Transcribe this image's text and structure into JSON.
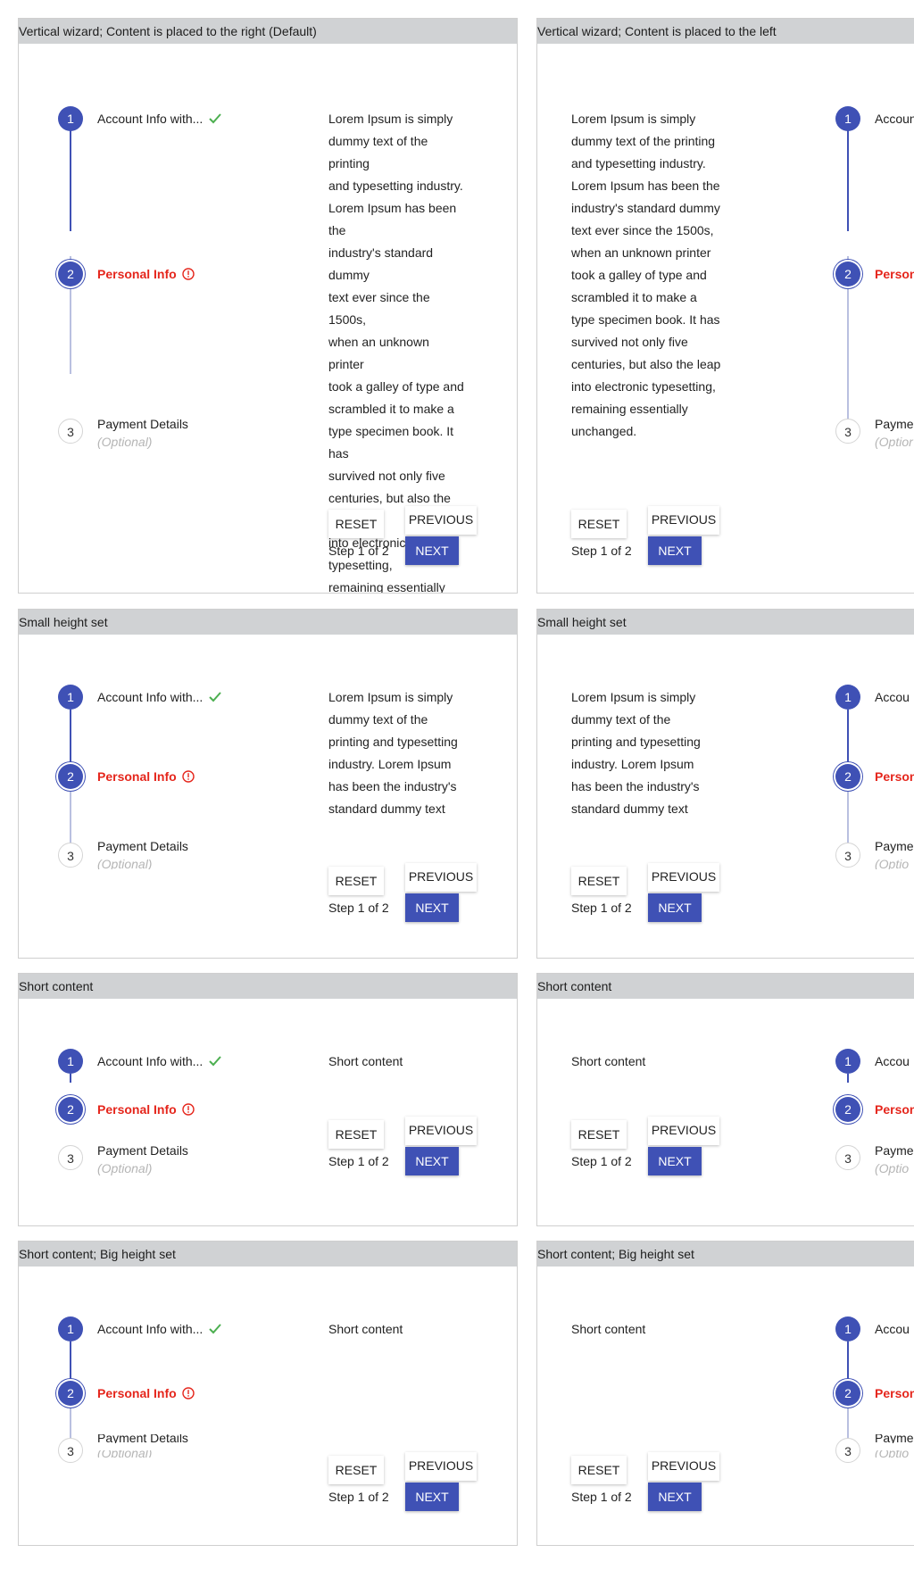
{
  "panels": [
    {
      "title": "Vertical wizard; Content is placed to the right (Default)"
    },
    {
      "title": "Vertical wizard; Content is placed to the left"
    },
    {
      "title": "Small height set"
    },
    {
      "title": "Small height set"
    },
    {
      "title": "Short content"
    },
    {
      "title": "Short content"
    },
    {
      "title": "Short content; Big height set"
    },
    {
      "title": "Short content; Big height set"
    }
  ],
  "steps": {
    "step1": {
      "number": "1",
      "label": "Account Info with...",
      "label_cut": "Accoun",
      "label_cut2": "Accou"
    },
    "step2": {
      "number": "2",
      "label": "Personal Info",
      "label_cut": "Person"
    },
    "step3": {
      "number": "3",
      "label": "Payment Details",
      "label_cut": "Payme",
      "optional": "(Optional)",
      "optional_cut": "(Optior",
      "optional_cut2": "(Optio"
    }
  },
  "content": {
    "long_lines": [
      "Lorem Ipsum is simply",
      "dummy text of the printing",
      "and typesetting industry.",
      "Lorem Ipsum has been the",
      "industry's standard dummy",
      "text ever since the 1500s,",
      "when an unknown printer",
      "took a galley of type and",
      "scrambled it to make a",
      "type specimen book. It has",
      "survived not only five",
      "centuries, but also the leap",
      "into electronic typesetting,",
      "remaining essentially",
      "unchanged."
    ],
    "small_lines": [
      "Lorem Ipsum is simply",
      "dummy text of the",
      "printing and typesetting",
      "industry. Lorem Ipsum",
      "has been the industry's",
      "standard dummy text"
    ],
    "short": "Short content"
  },
  "buttons": {
    "reset": "RESET",
    "previous": "PREVIOUS",
    "next": "NEXT"
  },
  "step_count": "Step 1 of 2",
  "colors": {
    "primary": "#3f51b5",
    "error": "#e5261c",
    "success": "#4caf50",
    "header_bg": "#d0d2d4"
  }
}
